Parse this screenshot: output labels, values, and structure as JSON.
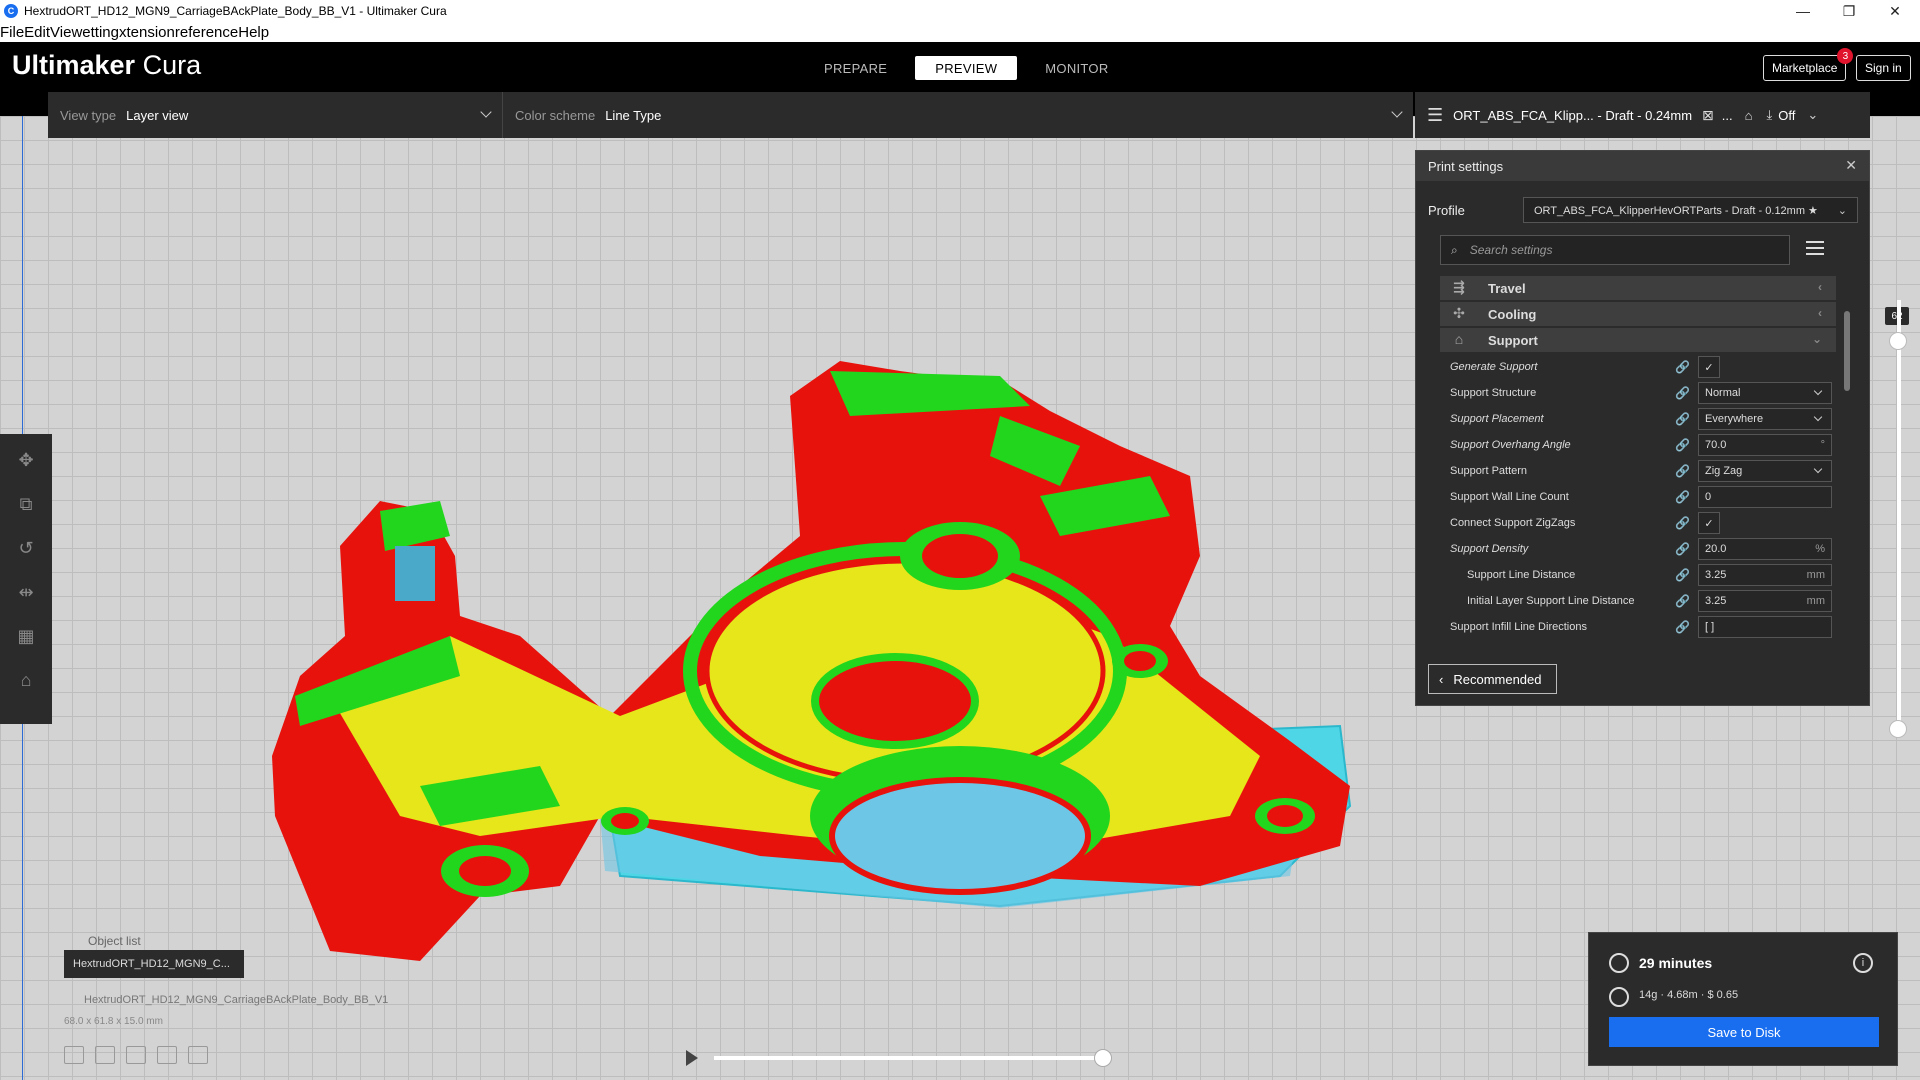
{
  "window": {
    "title": "HextrudORT_HD12_MGN9_CarriageBAckPlate_Body_BB_V1 - Ultimaker Cura",
    "app_icon": "C",
    "minimize": "—",
    "maximize": "❐",
    "close": "✕"
  },
  "menu": [
    "File",
    "Edit",
    "View",
    "Settings",
    "Extensions",
    "Preferences",
    "Help"
  ],
  "menu_visible": [
    "File",
    "Edit",
    "View",
    "etting",
    "xtension",
    "reference",
    "Help"
  ],
  "header": {
    "logo_bold": "Ultimaker",
    "logo_light": " Cura",
    "tabs": [
      {
        "label": "PREPARE",
        "active": false
      },
      {
        "label": "PREVIEW",
        "active": true
      },
      {
        "label": "MONITOR",
        "active": false
      }
    ],
    "marketplace_label": "Marketplace",
    "marketplace_badge": "3",
    "signin_label": "Sign in"
  },
  "toolbar": {
    "view_type_label": "View type",
    "view_type_value": "Layer view",
    "color_scheme_label": "Color scheme",
    "color_scheme_value": "Line Type",
    "print_setup_profile": "ORT_ABS_FCA_Klipp... - Draft - 0.24mm",
    "print_setup_extra": "...",
    "adhesion_value": "Off"
  },
  "print_settings": {
    "title": "Print settings",
    "profile_label": "Profile",
    "profile_value": "ORT_ABS_FCA_KlipperHevORTParts - Draft - 0.12mm ★",
    "search_placeholder": "Search settings",
    "categories": [
      {
        "label": "Travel",
        "icon": "travel-icon",
        "glyph": "⇶",
        "arrow": "‹"
      },
      {
        "label": "Cooling",
        "icon": "cooling-fan-icon",
        "glyph": "✣",
        "arrow": "‹"
      },
      {
        "label": "Support",
        "icon": "support-icon",
        "glyph": "⌂",
        "arrow": "⌄"
      }
    ],
    "settings": [
      {
        "name": "Generate Support",
        "italic": true,
        "indent": false,
        "value": "✓",
        "type": "check"
      },
      {
        "name": "Support Structure",
        "italic": false,
        "indent": false,
        "value": "Normal",
        "type": "select"
      },
      {
        "name": "Support Placement",
        "italic": true,
        "indent": false,
        "value": "Everywhere",
        "type": "select"
      },
      {
        "name": "Support Overhang Angle",
        "italic": true,
        "indent": false,
        "value": "70.0",
        "unit": "°",
        "type": "text"
      },
      {
        "name": "Support Pattern",
        "italic": false,
        "indent": false,
        "value": "Zig Zag",
        "type": "select"
      },
      {
        "name": "Support Wall Line Count",
        "italic": false,
        "indent": false,
        "value": "0",
        "type": "text"
      },
      {
        "name": "Connect Support ZigZags",
        "italic": false,
        "indent": false,
        "value": "✓",
        "type": "check"
      },
      {
        "name": "Support Density",
        "italic": true,
        "indent": false,
        "value": "20.0",
        "unit": "%",
        "type": "text"
      },
      {
        "name": "Support Line Distance",
        "italic": false,
        "indent": true,
        "value": "3.25",
        "unit": "mm",
        "type": "text"
      },
      {
        "name": "Initial Layer Support Line Distance",
        "italic": false,
        "indent": true,
        "value": "3.25",
        "unit": "mm",
        "type": "text"
      },
      {
        "name": "Support Infill Line Directions",
        "italic": false,
        "indent": false,
        "value": "[ ]",
        "type": "text"
      }
    ],
    "recommended_label": "Recommended",
    "close_glyph": "✕",
    "link_glyph": "🔗"
  },
  "layer_slider": {
    "current_layer": "62"
  },
  "object": {
    "list_label": "Object list",
    "chip_name": "HextrudORT_HD12_MGN9_C...",
    "full_name": "HextrudORT_HD12_MGN9_CarriageBAckPlate_Body_BB_V1",
    "dimensions": "68.0 x 61.8 x 15.0 mm"
  },
  "output": {
    "time": "29 minutes",
    "stats": "14g · 4.68m · $ 0.65",
    "save_label": "Save to Disk",
    "info_glyph": "i"
  },
  "colors": {
    "accent": "#196ef0",
    "wall_red": "#e8120c",
    "infill_yellow": "#e8e414",
    "inner_wall_green": "#22d61e",
    "support_cyan": "#45d8e8",
    "panel_bg": "#2b2b2b"
  }
}
